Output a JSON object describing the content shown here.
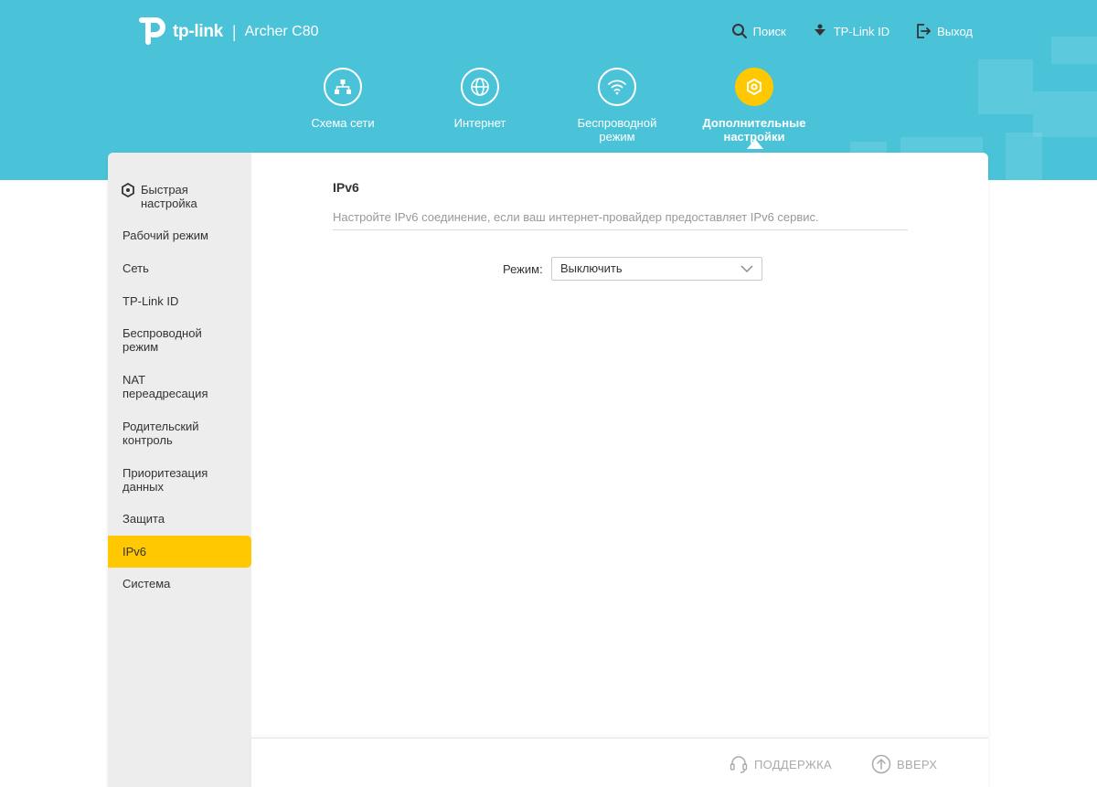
{
  "header": {
    "brand": "tp-link",
    "model": "Archer C80",
    "links": [
      {
        "icon": "search-icon",
        "label": "Поиск"
      },
      {
        "icon": "tplink-id-icon",
        "label": "TP-Link ID"
      },
      {
        "icon": "logout-icon",
        "label": "Выход"
      }
    ]
  },
  "nav": {
    "items": [
      {
        "icon": "network-map-icon",
        "label": "Схема сети"
      },
      {
        "icon": "internet-globe-icon",
        "label": "Интернет"
      },
      {
        "icon": "wifi-icon",
        "label": "Беспроводной режим"
      },
      {
        "icon": "advanced-gear-icon",
        "label": "Дополнительные настройки",
        "active": true
      }
    ]
  },
  "sidebar": {
    "quick_setup": {
      "icon": "quick-setup-icon",
      "label": "Быстрая настройка"
    },
    "items": [
      {
        "label": "Рабочий режим"
      },
      {
        "label": "Сеть"
      },
      {
        "label": "TP-Link ID"
      },
      {
        "label": "Беспроводной режим"
      },
      {
        "label": "NAT переадресация"
      },
      {
        "label": "Родительский контроль"
      },
      {
        "label": "Приоритезация данных"
      },
      {
        "label": "Защита"
      },
      {
        "label": "IPv6",
        "active": true
      },
      {
        "label": "Система"
      }
    ]
  },
  "content": {
    "title": "IPv6",
    "description": "Настройте IPv6 соединение, если ваш интернет-провайдер предоставляет IPv6 сервис.",
    "mode": {
      "label": "Режим:",
      "value": "Выключить"
    }
  },
  "footer": {
    "support": {
      "icon": "headset-icon",
      "label": "ПОДДЕРЖКА"
    },
    "top": {
      "icon": "arrow-up-circle-icon",
      "label": "ВВЕРХ"
    }
  },
  "colors": {
    "header_bg": "#4ac3d9",
    "accent": "#ffc800",
    "sidebar_bg": "#ededed"
  }
}
